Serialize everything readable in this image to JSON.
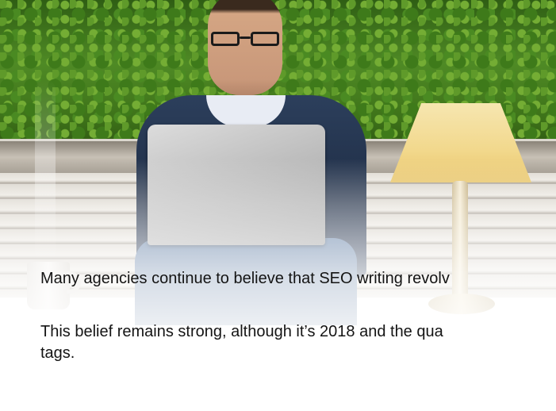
{
  "hero": {
    "icon": "photo-man-on-bench-with-laptop-and-lamp"
  },
  "article": {
    "paragraphs": [
      "Many agencies continue to believe that SEO writing revolv",
      "This belief remains strong, although it’s 2018 and the qua",
      "tags."
    ]
  }
}
